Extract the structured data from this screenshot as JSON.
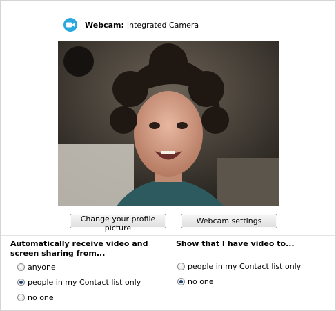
{
  "webcam": {
    "label": "Webcam:",
    "device": "Integrated Camera",
    "icon": "video-camera-icon"
  },
  "preview": {
    "description_icon": "webcam-preview"
  },
  "buttons": {
    "change_profile": "Change your profile picture",
    "webcam_settings": "Webcam settings"
  },
  "receive": {
    "title": "Automatically receive video and screen sharing from...",
    "options": [
      {
        "label": "anyone",
        "selected": false
      },
      {
        "label": "people in my Contact list only",
        "selected": true
      },
      {
        "label": "no one",
        "selected": false
      }
    ]
  },
  "show": {
    "title": "Show that I have video to...",
    "options": [
      {
        "label": "people in my Contact list only",
        "selected": false
      },
      {
        "label": "no one",
        "selected": true
      }
    ]
  },
  "colors": {
    "accent": "#29a9e0",
    "radio_selected": "#1b3d6b"
  }
}
